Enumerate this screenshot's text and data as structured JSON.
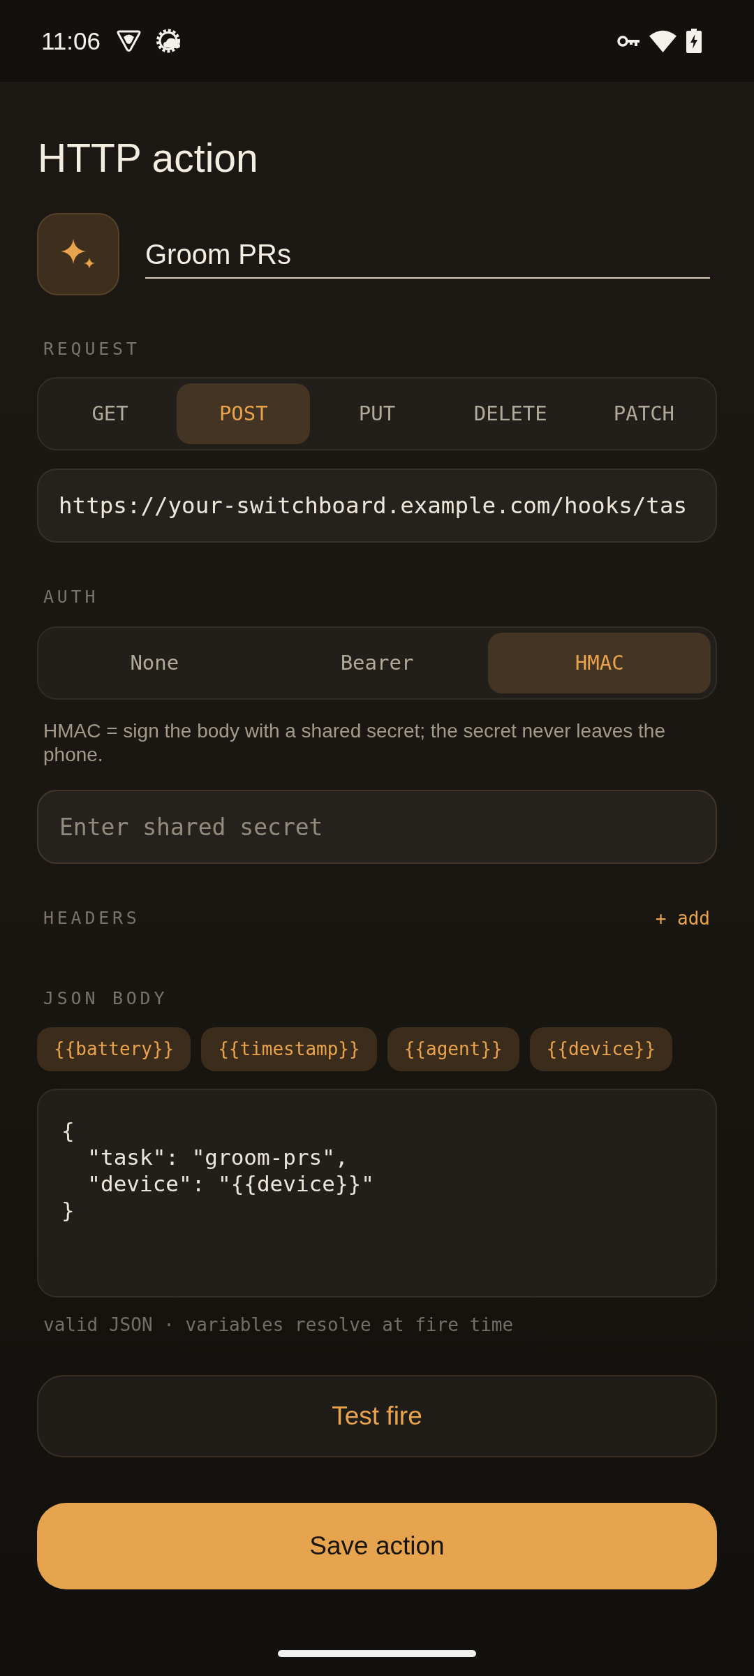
{
  "status_bar": {
    "time": "11:06"
  },
  "title": "HTTP action",
  "action": {
    "name": "Groom PRs"
  },
  "request": {
    "label": "REQUEST",
    "methods": [
      {
        "label": "GET",
        "selected": false
      },
      {
        "label": "POST",
        "selected": true
      },
      {
        "label": "PUT",
        "selected": false
      },
      {
        "label": "DELETE",
        "selected": false
      },
      {
        "label": "PATCH",
        "selected": false
      }
    ],
    "url": "https://your-switchboard.example.com/hooks/tas"
  },
  "auth": {
    "label": "AUTH",
    "options": [
      {
        "label": "None",
        "selected": false
      },
      {
        "label": "Bearer",
        "selected": false
      },
      {
        "label": "HMAC",
        "selected": true
      }
    ],
    "note": "HMAC = sign the body with a shared secret; the secret never leaves the phone.",
    "secret": {
      "placeholder": "Enter shared secret"
    }
  },
  "headers": {
    "label": "HEADERS",
    "add": "+ add"
  },
  "body": {
    "label": "JSON BODY",
    "variables": [
      "{{battery}}",
      "{{timestamp}}",
      "{{agent}}",
      "{{device}}"
    ],
    "value": "{\n  \"task\": \"groom-prs\",\n  \"device\": \"{{device}}\"\n}",
    "hint": "valid JSON · variables resolve at fire time"
  },
  "buttons": {
    "test": "Test fire",
    "save": "Save action"
  }
}
